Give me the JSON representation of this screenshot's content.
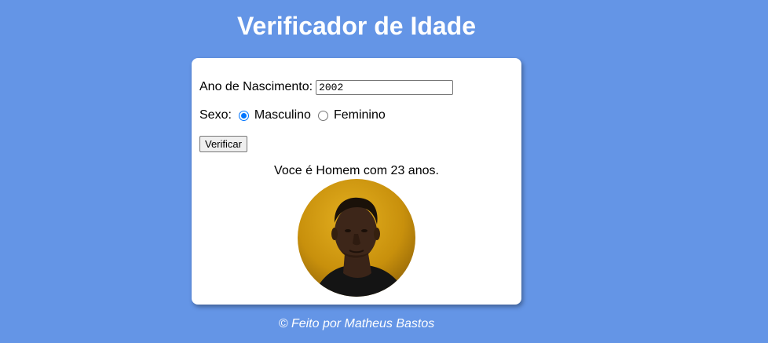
{
  "page": {
    "title": "Verificador de Idade",
    "footer": "© Feito por Matheus Bastos"
  },
  "form": {
    "year_label": "Ano de Nascimento:",
    "year_value": "2002",
    "sex_label": "Sexo:",
    "options": [
      {
        "label": "Masculino",
        "checked": true
      },
      {
        "label": "Feminino",
        "checked": false
      }
    ],
    "verify_label": "Verificar"
  },
  "result": {
    "text": "Voce é Homem com 23 anos.",
    "avatar": "man-portrait"
  },
  "colors": {
    "background": "#6495e6",
    "card": "#ffffff",
    "accent": "#0075ff",
    "photo_bg": "#d19a10"
  }
}
